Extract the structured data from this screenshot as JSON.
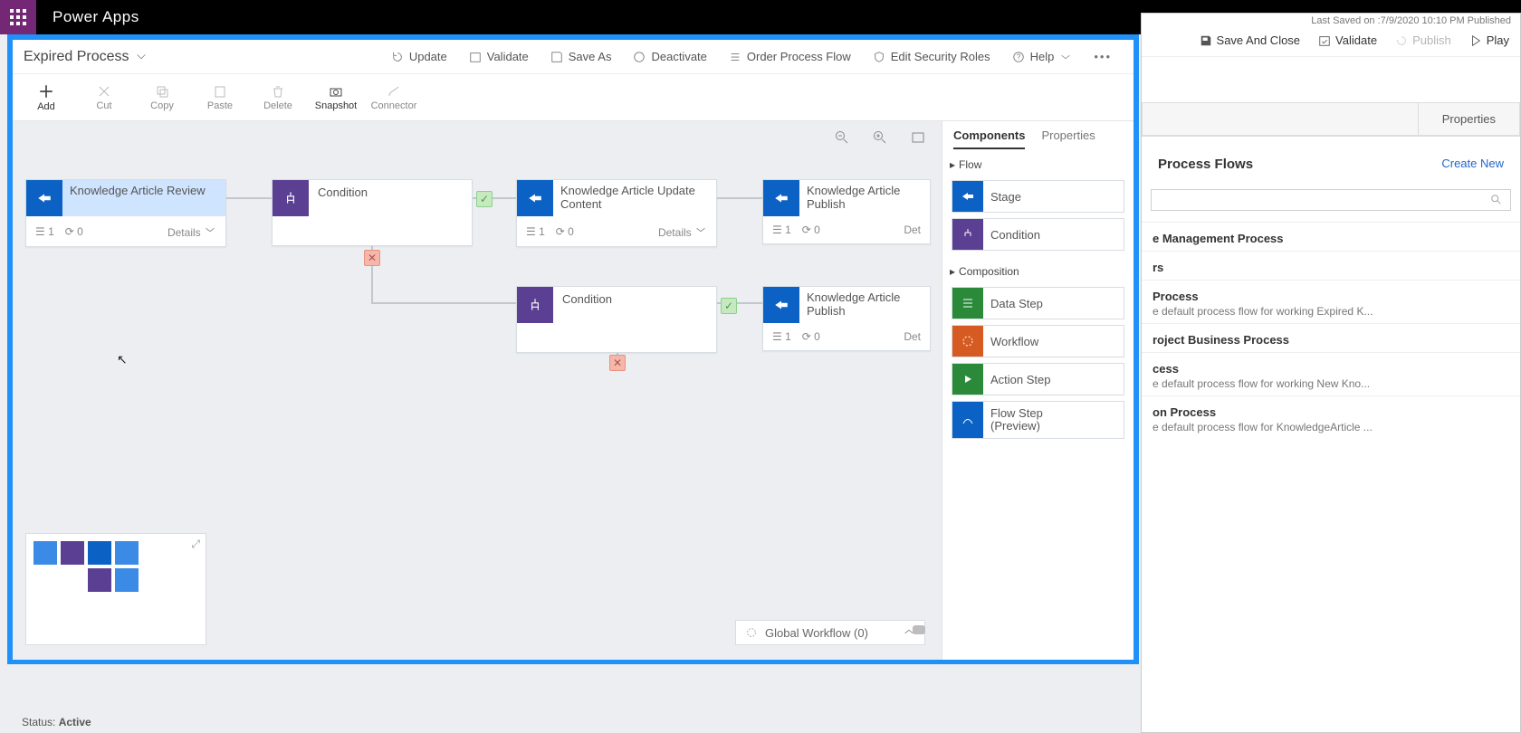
{
  "app": {
    "name": "Power Apps"
  },
  "rightPane": {
    "lastSaved": "Last Saved on :7/9/2020 10:10 PM Published",
    "buttons": {
      "saveAndClose": "Save And Close",
      "validate": "Validate",
      "publish": "Publish",
      "play": "Play"
    },
    "tabs": {
      "componentsHidden": "",
      "properties": "Properties"
    },
    "sectionTitle": "Process Flows",
    "createNew": "Create New",
    "searchPlaceholder": "",
    "items": [
      {
        "name": "e Management Process",
        "desc": ""
      },
      {
        "name": "rs",
        "desc": ""
      },
      {
        "name": "Process",
        "desc": "e default process flow for working Expired K..."
      },
      {
        "name": "roject Business Process",
        "desc": ""
      },
      {
        "name": "cess",
        "desc": "e default process flow for working New Kno..."
      },
      {
        "name": "on Process",
        "desc": "e default process flow for KnowledgeArticle ..."
      }
    ]
  },
  "editor": {
    "processName": "Expired Process",
    "topButtons": {
      "update": "Update",
      "validate": "Validate",
      "saveAs": "Save As",
      "deactivate": "Deactivate",
      "orderProcessFlow": "Order Process Flow",
      "editSecurityRoles": "Edit Security Roles",
      "help": "Help"
    },
    "toolbar": {
      "add": "Add",
      "cut": "Cut",
      "copy": "Copy",
      "paste": "Paste",
      "delete": "Delete",
      "snapshot": "Snapshot",
      "connector": "Connector"
    },
    "stages": {
      "s1": {
        "title": "Knowledge Article Review",
        "steps": "1",
        "pending": "0",
        "details": "Details"
      },
      "s2": {
        "title": "Condition"
      },
      "s3": {
        "title": "Knowledge Article Update Content",
        "steps": "1",
        "pending": "0",
        "details": "Details"
      },
      "s4": {
        "title": "Knowledge Article Publish",
        "steps": "1",
        "pending": "0",
        "details": "Det"
      },
      "s5": {
        "title": "Condition"
      },
      "s6": {
        "title": "Knowledge Article Publish",
        "steps": "1",
        "pending": "0",
        "details": "Det"
      }
    },
    "sidePanel": {
      "tabs": {
        "components": "Components",
        "properties": "Properties"
      },
      "groups": {
        "flow": "Flow",
        "composition": "Composition"
      },
      "items": {
        "stage": "Stage",
        "condition": "Condition",
        "dataStep": "Data Step",
        "workflow": "Workflow",
        "actionStep": "Action Step",
        "flowStep": "Flow Step\n(Preview)"
      }
    },
    "globalWorkflow": "Global Workflow (0)"
  },
  "statusBar": {
    "label": "Status:",
    "value": "Active"
  }
}
